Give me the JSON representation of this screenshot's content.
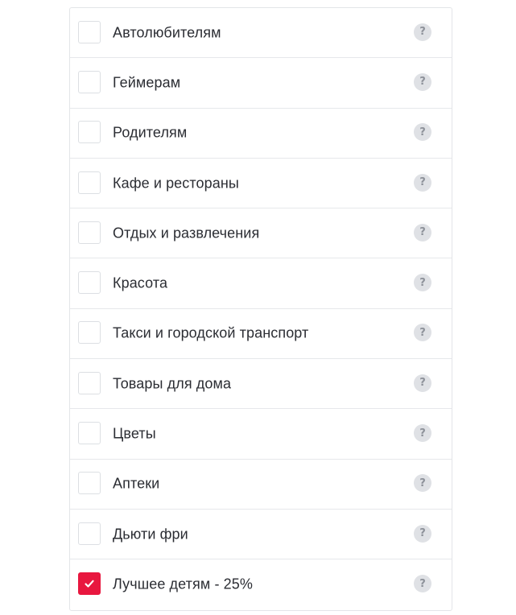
{
  "categories": {
    "items": [
      {
        "label": "Автолюбителям",
        "checked": false,
        "help": "?"
      },
      {
        "label": "Геймерам",
        "checked": false,
        "help": "?"
      },
      {
        "label": "Родителям",
        "checked": false,
        "help": "?"
      },
      {
        "label": "Кафе и рестораны",
        "checked": false,
        "help": "?"
      },
      {
        "label": "Отдых и развлечения",
        "checked": false,
        "help": "?"
      },
      {
        "label": "Красота",
        "checked": false,
        "help": "?"
      },
      {
        "label": "Такси и городской транспорт",
        "checked": false,
        "help": "?"
      },
      {
        "label": "Товары для дома",
        "checked": false,
        "help": "?"
      },
      {
        "label": "Цветы",
        "checked": false,
        "help": "?"
      },
      {
        "label": "Аптеки",
        "checked": false,
        "help": "?"
      },
      {
        "label": "Дьюти фри",
        "checked": false,
        "help": "?"
      },
      {
        "label": "Лучшее детям - 25%",
        "checked": true,
        "help": "?"
      }
    ]
  },
  "colors": {
    "accent": "#e8173f",
    "text": "#2b2d33",
    "help_bg": "#dfe1e5",
    "help_fg": "#8d9199",
    "border": "#e6e8eb"
  },
  "icons": {
    "checkbox_mark": "checkmark-icon",
    "help": "question-mark-icon"
  }
}
